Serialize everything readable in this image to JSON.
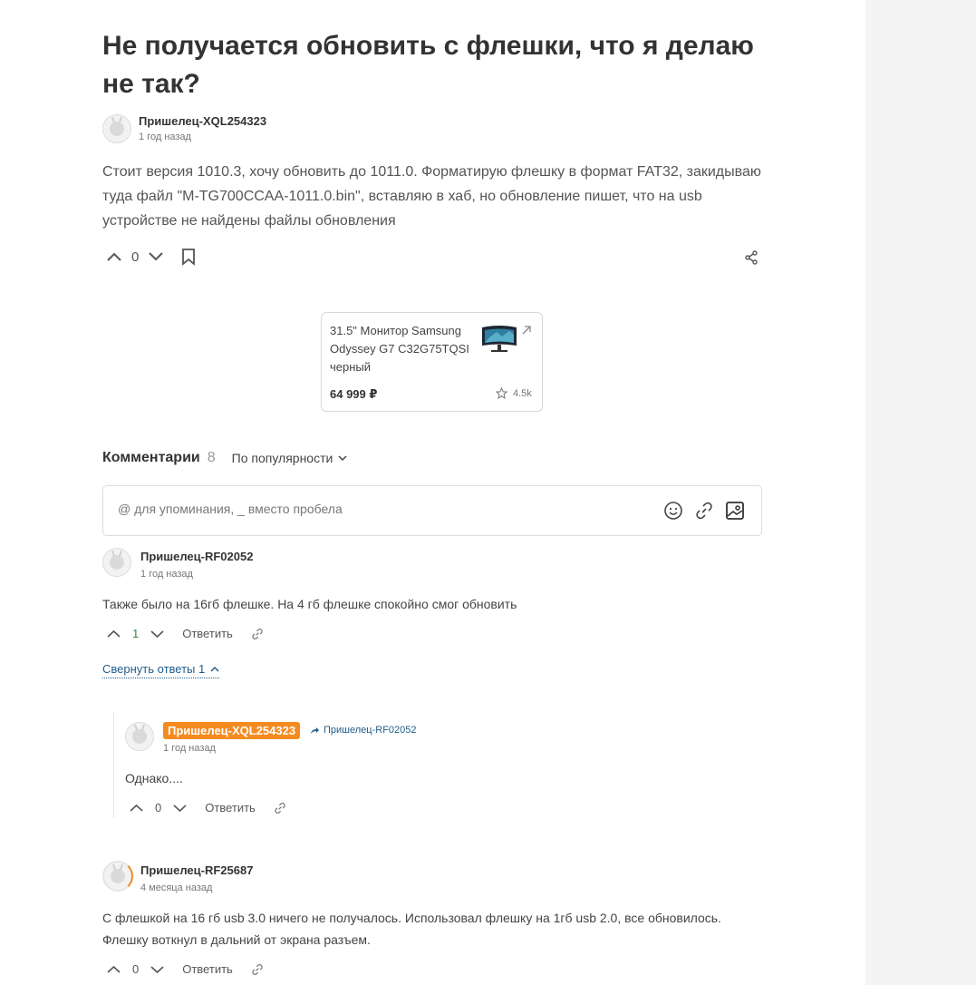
{
  "question": {
    "title": "Не получается обновить с флешки, что я делаю не так?",
    "author": "Пришелец-XQL254323",
    "time": "1 год назад",
    "body": "Стоит версия 1010.3, хочу обновить до 1011.0. Форматирую флешку в формат FAT32, закидываю туда файл \"M-TG700CCAA-1011.0.bin\", вставляю в хаб, но обновление пишет, что на usb устройстве не найдены файлы обновления",
    "votes": "0"
  },
  "product": {
    "name": "31.5\" Монитор Samsung Odyssey G7 C32G75TQSI черный",
    "price": "64 999 ₽",
    "rating": "4.5k"
  },
  "comments_section": {
    "label": "Комментарии",
    "count": "8",
    "sort_label": "По популярности",
    "input_placeholder": "@ для упоминания, _ вместо пробела"
  },
  "comments": [
    {
      "author": "Пришелец-RF02052",
      "time": "1 год назад",
      "text": "Также было на 16гб флешке. На 4 гб флешке спокойно смог обновить",
      "votes": "1",
      "reply_label": "Ответить",
      "collapse_label": "Свернуть ответы 1"
    },
    {
      "author": "Пришелец-XQL254323",
      "reply_to": "Пришелец-RF02052",
      "time": "1 год назад",
      "text": "Однако....",
      "votes": "0",
      "reply_label": "Ответить"
    },
    {
      "author": "Пришелец-RF25687",
      "time": "4 месяца назад",
      "text": "С флешкой на 16 гб usb 3.0 ничего не получалось. Использовал флешку на 1гб usb 2.0, все обновилось. Флешку воткнул в дальний от экрана разъем.",
      "votes": "0",
      "reply_label": "Ответить"
    }
  ],
  "colors": {
    "accent_orange": "#f58b1f",
    "link_blue": "#1f5d8a",
    "positive_green": "#2a8a3a"
  }
}
